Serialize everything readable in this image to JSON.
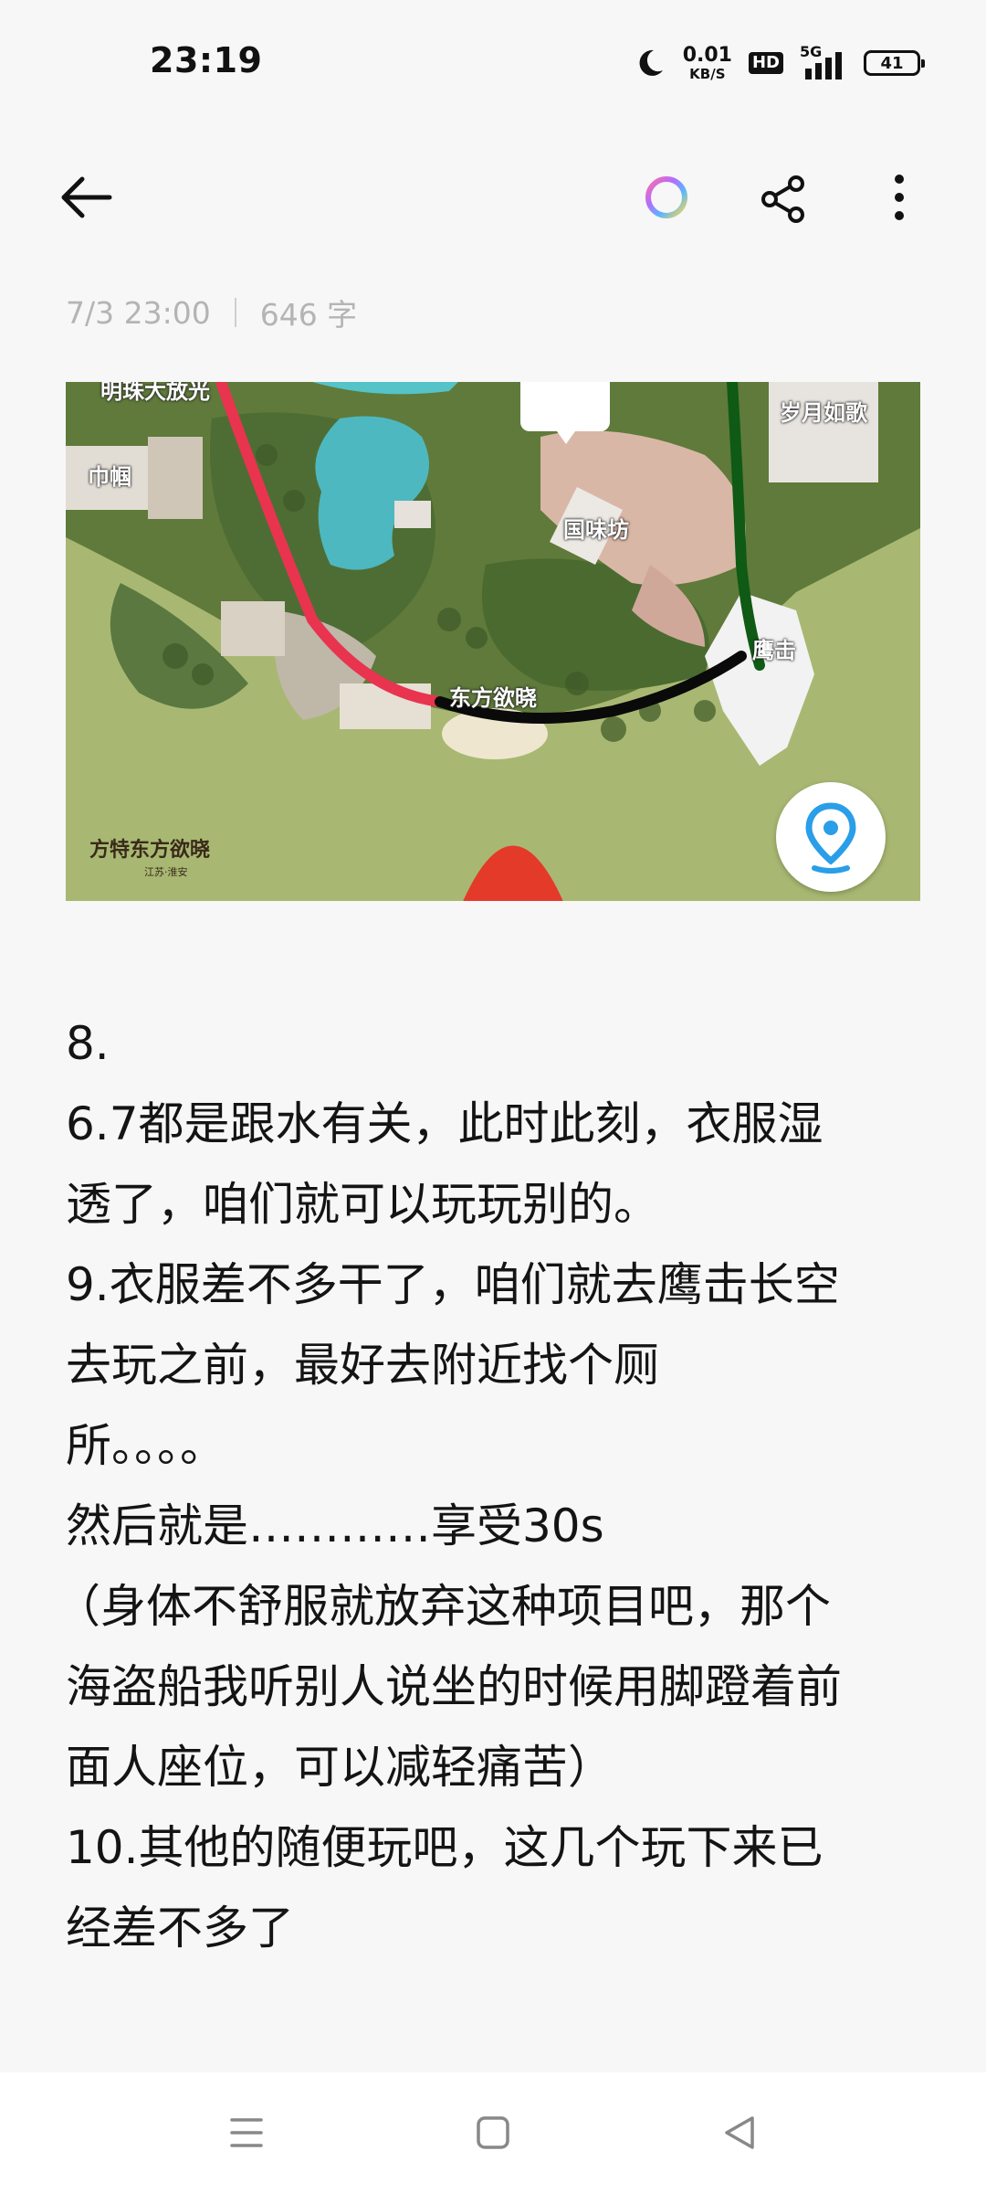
{
  "status_bar": {
    "time": "23:19",
    "net_speed_value": "0.01",
    "net_speed_unit": "KB/S",
    "hd_badge": "HD",
    "network": "5G",
    "battery": "41",
    "icons": [
      "moon-icon",
      "hd-icon",
      "signal-icon",
      "battery-icon"
    ]
  },
  "toolbar": {
    "icons": [
      "back-arrow-icon",
      "color-ring-icon",
      "share-icon",
      "more-vertical-icon"
    ]
  },
  "meta": {
    "datetime": "7/3 23:00",
    "word_count": "646 字"
  },
  "map": {
    "labels": {
      "top_left": "明珠大放光",
      "left": "巾帼",
      "center": "国味坊",
      "top_right": "岁月如歌",
      "right": "鹰击",
      "bottom_center": "东方欲晓"
    },
    "logo_text": "方特东方欲晓",
    "logo_sub": "江苏·淮安",
    "route_colors": {
      "red": "#e8344f",
      "black": "#0a0a0a",
      "green": "#0f5a14"
    }
  },
  "note": {
    "lines": [
      "8.",
      "6.7都是跟水有关，此时此刻，衣服湿",
      "透了，咱们就可以玩玩别的。",
      "9.衣服差不多干了，咱们就去鹰击长空",
      "去玩之前，最好去附近找个厕",
      "所。。。。",
      "然后就是…………享受30s",
      "（身体不舒服就放弃这种项目吧，那个",
      "海盗船我听别人说坐的时候用脚蹬着前",
      "面人座位，可以减轻痛苦）",
      "10.其他的随便玩吧，这几个玩下来已",
      "经差不多了"
    ]
  },
  "nav_bar": {
    "icons": [
      "menu-icon",
      "home-square-icon",
      "back-triangle-icon"
    ]
  }
}
